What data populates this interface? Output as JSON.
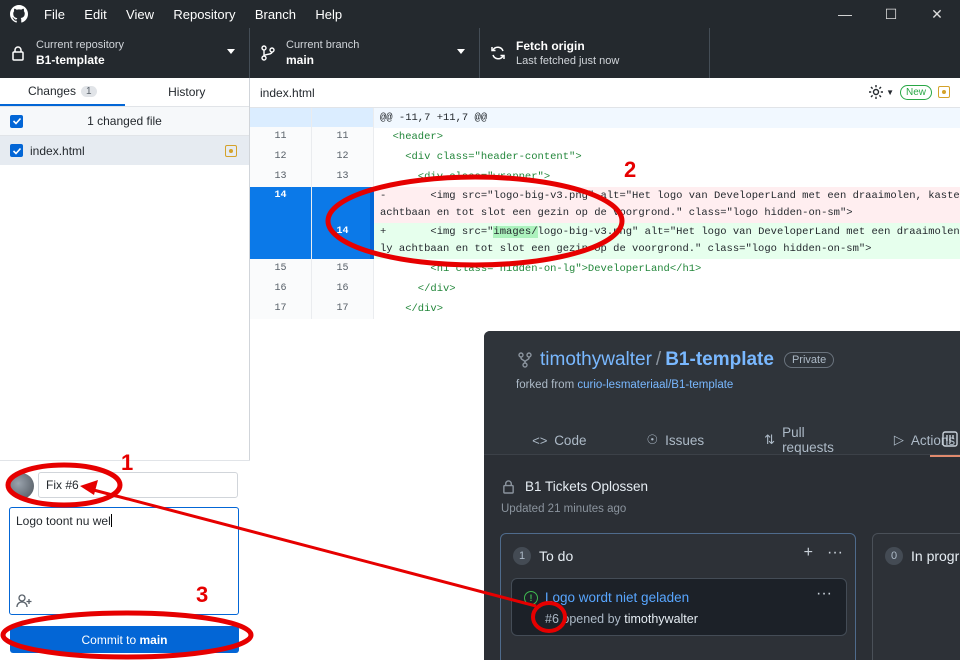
{
  "menu": [
    "File",
    "Edit",
    "View",
    "Repository",
    "Branch",
    "Help"
  ],
  "toolbar": {
    "repo_label": "Current repository",
    "repo_value": "B1-template",
    "branch_label": "Current branch",
    "branch_value": "main",
    "fetch_title": "Fetch origin",
    "fetch_sub": "Last fetched just now"
  },
  "tabs": {
    "changes": "Changes",
    "changes_count": "1",
    "history": "History"
  },
  "changed_files_label": "1 changed file",
  "file_name": "index.html",
  "commit": {
    "summary": "Fix #6",
    "description": "Logo toont nu wel",
    "button_prefix": "Commit to ",
    "button_branch": "main"
  },
  "diff": {
    "file": "index.html",
    "new_badge": "New",
    "hunk": "@@ -11,7 +11,7 @@",
    "lines": [
      {
        "o": "11",
        "n": "11",
        "text": "  <header>"
      },
      {
        "o": "12",
        "n": "12",
        "text": "    <div class=\"header-content\">"
      },
      {
        "o": "13",
        "n": "13",
        "text": "      <div class=\"wrapper\">"
      },
      {
        "o": "14",
        "del1": "-       <img src=\"logo-big-v3.png\" alt=\"Het logo van DeveloperLand met een draaimolen, kasteel,",
        "del2": "achtbaan en tot slot een gezin op de voorgrond.\" class=\"logo hidden-on-sm\">"
      },
      {
        "n": "14",
        "add1a": "+       <img src=\"",
        "add1hl": "images/",
        "add1b": "logo-big-v3.png\" alt=\"Het logo van DeveloperLand met een draaimolen, k",
        "add2": "ly achtbaan en tot slot een gezin op de voorgrond.\" class=\"logo hidden-on-sm\">"
      },
      {
        "o": "15",
        "n": "15",
        "text": "        <h1 class=\"hidden-on-lg\">DeveloperLand</h1>"
      },
      {
        "o": "16",
        "n": "16",
        "text": "      </div>"
      },
      {
        "o": "17",
        "n": "17",
        "text": "    </div>"
      }
    ]
  },
  "github": {
    "owner": "timothywalter",
    "repo": "B1-template",
    "visibility": "Private",
    "forked_prefix": "forked from ",
    "forked_from": "curio-lesmateriaal/B1-template",
    "tabs": [
      "Code",
      "Issues",
      "Pull requests",
      "Actions"
    ],
    "project_title": "B1 Tickets Oplossen",
    "updated": "Updated 21 minutes ago",
    "col1": {
      "count": "1",
      "name": "To do"
    },
    "col2": {
      "count": "0",
      "name": "In progr"
    },
    "card": {
      "title": "Logo wordt niet geladen",
      "number": "#6",
      "opened_by": "opened by ",
      "author": "timothywalter"
    }
  },
  "annotations": [
    "1",
    "2",
    "3"
  ],
  "colors": {
    "accent": "#0366d6",
    "annotation": "#e60000",
    "titlebar": "#24292e"
  }
}
